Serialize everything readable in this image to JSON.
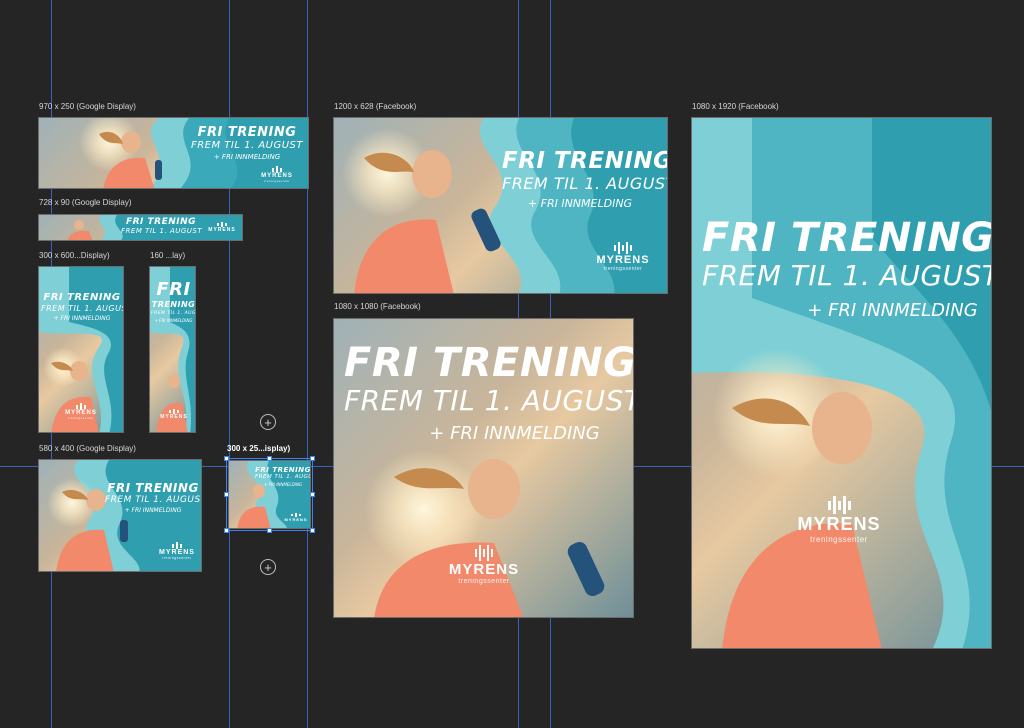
{
  "frames": [
    {
      "id": "f970",
      "label": "970 x 250 (Google Display)"
    },
    {
      "id": "f728",
      "label": "728 x 90 (Google Display)"
    },
    {
      "id": "f300x600",
      "label": "300 x 600...Display)"
    },
    {
      "id": "f160",
      "label": "160 ...lay)"
    },
    {
      "id": "f580",
      "label": "580 x 400 (Google Display)"
    },
    {
      "id": "f300x250",
      "label": "300 x 25...isplay)"
    },
    {
      "id": "f1200",
      "label": "1200 x 628 (Facebook)"
    },
    {
      "id": "f1080sq",
      "label": "1080 x 1080 (Facebook)"
    },
    {
      "id": "f1080v",
      "label": "1080 x 1920 (Facebook)"
    }
  ],
  "ad": {
    "headline": "FRI TRENING",
    "headline_short": "FRI",
    "headline_short_2": "TRENING",
    "subline": "FREM TIL 1. AUGUST",
    "offer": "+ FRI INNMELDING",
    "brand": "MYRENS",
    "brand_sub": "treningssenter"
  },
  "colors": {
    "canvas": "#252525",
    "guide": "#3d6fd6",
    "wave_light": "#7fd0d6",
    "wave_dark": "#2f9fb0",
    "shirt": "#f2896a",
    "selection": "#3b82f6"
  },
  "icons": [
    "add-icon",
    "add-icon",
    "runner-image",
    "logo-mark-icon"
  ]
}
